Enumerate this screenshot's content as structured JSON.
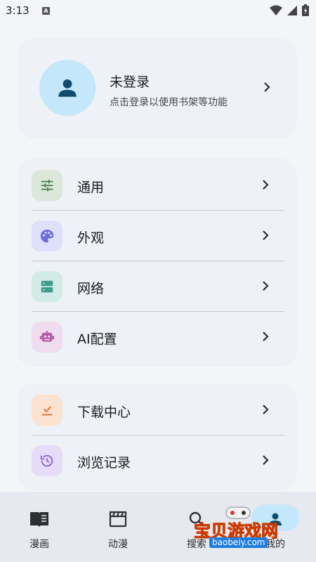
{
  "status_bar": {
    "time": "3:13",
    "notification_badge": "A"
  },
  "account": {
    "title": "未登录",
    "subtitle": "点击登录以使用书架等功能",
    "avatar_icon": "person-icon"
  },
  "settings": {
    "items": [
      {
        "label": "通用",
        "icon": "sliders-icon",
        "bg": "#dbe8d9",
        "color": "#4b7d47"
      },
      {
        "label": "外观",
        "icon": "palette-icon",
        "bg": "#dfe0fb",
        "color": "#6b6ed8"
      },
      {
        "label": "网络",
        "icon": "server-icon",
        "bg": "#d2ebe6",
        "color": "#3f9b8a"
      },
      {
        "label": "AI配置",
        "icon": "robot-icon",
        "bg": "#f0dcef",
        "color": "#b45aa8"
      }
    ]
  },
  "library": {
    "items": [
      {
        "label": "下载中心",
        "icon": "download-check-icon",
        "bg": "#fbe2d1",
        "color": "#e07b32"
      },
      {
        "label": "浏览记录",
        "icon": "history-icon",
        "bg": "#e6dcf7",
        "color": "#8a62c9"
      }
    ]
  },
  "bottom_nav": {
    "items": [
      {
        "label": "漫画",
        "icon": "book-icon"
      },
      {
        "label": "动漫",
        "icon": "clapperboard-icon"
      },
      {
        "label": "搜索",
        "icon": "search-icon"
      },
      {
        "label": "我的",
        "icon": "person-icon",
        "selected": true
      }
    ]
  },
  "watermark": {
    "title": "宝贝游戏网",
    "url": "baobeiy.com"
  },
  "colors": {
    "accent": "#c5e7fb",
    "background": "#f3f5f9",
    "card": "#eef1f6"
  }
}
